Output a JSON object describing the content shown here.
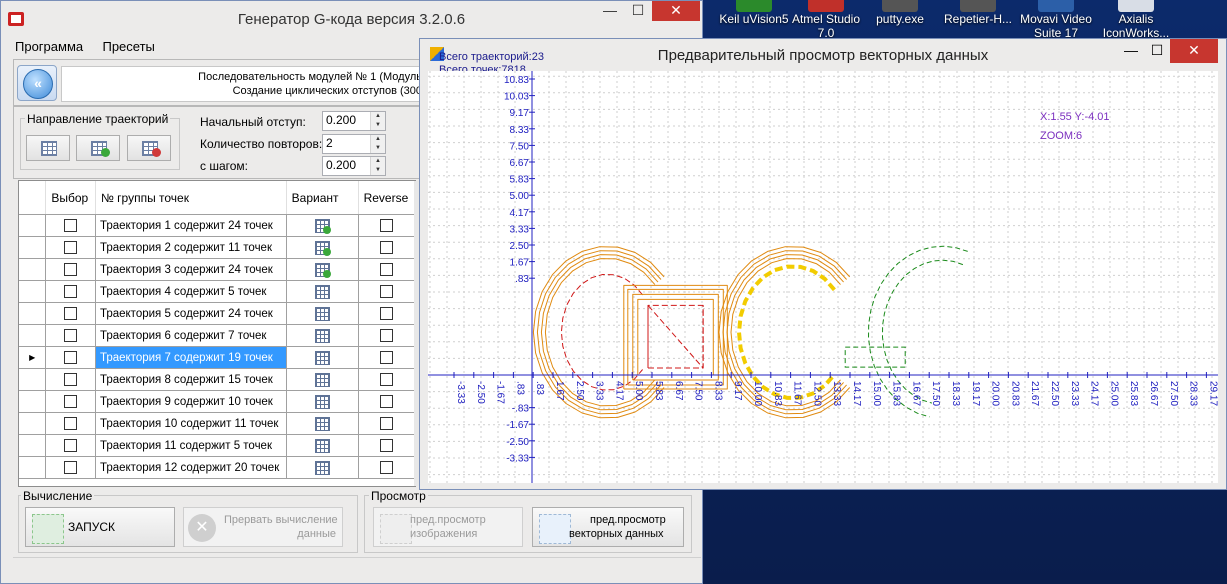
{
  "desktop": {
    "icons": [
      {
        "label": "Keil uVision5",
        "color": "#2b8a2b"
      },
      {
        "label": "Atmel Studio 7.0",
        "color": "#c0302a"
      },
      {
        "label": "putty.exe",
        "color": "#555555"
      },
      {
        "label": "Repetier-H...",
        "color": "#555555"
      },
      {
        "label": "Movavi Video Suite 17",
        "color": "#2c5fa8"
      },
      {
        "label": "Axialis IconWorks...",
        "color": "#d8dde6"
      }
    ]
  },
  "main": {
    "title": "Генератор G-кода версия 3.2.0.6",
    "menu": [
      "Программа",
      "Пресеты"
    ],
    "info_lines": [
      "Последовательность модулей № 1 (Модуль",
      "Создание циклических отступов (300"
    ],
    "direction_group": "Направление траекторий",
    "fields": [
      {
        "label": "Начальный отступ:",
        "value": "0.200"
      },
      {
        "label": "Количество повторов:",
        "value": "2"
      },
      {
        "label": "с шагом:",
        "value": "0.200"
      }
    ],
    "table": {
      "headers": [
        "Выбор",
        "№ группы точек",
        "Вариант",
        "Reverse"
      ],
      "selected_index": 6,
      "rows": [
        {
          "text": "Траектория 1 содержит 24 точек",
          "plus": true
        },
        {
          "text": "Траектория 2 содержит 11 точек",
          "plus": true
        },
        {
          "text": "Траектория 3 содержит 24 точек",
          "plus": true
        },
        {
          "text": "Траектория 4 содержит 5 точек",
          "plus": false
        },
        {
          "text": "Траектория 5 содержит 24 точек",
          "plus": false
        },
        {
          "text": "Траектория 6 содержит 7 точек",
          "plus": false
        },
        {
          "text": "Траектория 7 содержит 19 точек",
          "plus": false
        },
        {
          "text": "Траектория 8 содержит 15 точек",
          "plus": false
        },
        {
          "text": "Траектория 9 содержит 10 точек",
          "plus": false
        },
        {
          "text": "Траектория 10 содержит 11 точек",
          "plus": false
        },
        {
          "text": "Траектория 11 содержит 5 точек",
          "plus": false
        },
        {
          "text": "Траектория 12 содержит 20 точек",
          "plus": false
        }
      ]
    },
    "calc_group": "Вычисление",
    "preview_group": "Просмотр",
    "run_label": "ЗАПУСК",
    "stop_label_1": "Прервать вычисление",
    "stop_label_2": "данные",
    "preview_image_1": "пред.просмотр",
    "preview_image_2": "изображения",
    "preview_vector_1": "пред.просмотр",
    "preview_vector_2": "векторных данных"
  },
  "preview": {
    "title": "Предварительный просмотр векторных данных",
    "stat_trajectories": "Всего траекторий:23",
    "stat_points": "Всего точек:7818",
    "cursor_readout": "X:1.55 Y:-4.01",
    "zoom_readout": "ZOOM:6",
    "x_ticks": [
      "-3.33",
      "-2.50",
      "-1.67",
      ".83",
      ".83",
      "1.67",
      "2.50",
      "3.33",
      "4.17",
      "5.00",
      "5.83",
      "6.67",
      "7.50",
      "8.33",
      "9.17",
      "10.00",
      "10.83",
      "11.67",
      "12.50",
      "13.33",
      "14.17",
      "15.00",
      "15.83",
      "16.67",
      "17.50",
      "18.33",
      "19.17",
      "20.00",
      "20.83",
      "21.67",
      "22.50",
      "23.33",
      "24.17",
      "25.00",
      "25.83",
      "26.67",
      "27.50",
      "28.33",
      "29.17"
    ],
    "y_ticks": [
      "10.83",
      "10.03",
      "9.17",
      "8.33",
      "7.50",
      "6.67",
      "5.83",
      "5.00",
      "4.17",
      "3.33",
      "2.50",
      "1.67",
      ".83",
      "-.83",
      "-1.67",
      "-2.50",
      "-3.33"
    ],
    "colors": {
      "offset": "#e08a10",
      "path_red": "#d01818",
      "path_yellow": "#f2cc00",
      "path_green": "#1a8a1a",
      "axis": "#2020c0",
      "grid": "#cfcfcf"
    }
  }
}
